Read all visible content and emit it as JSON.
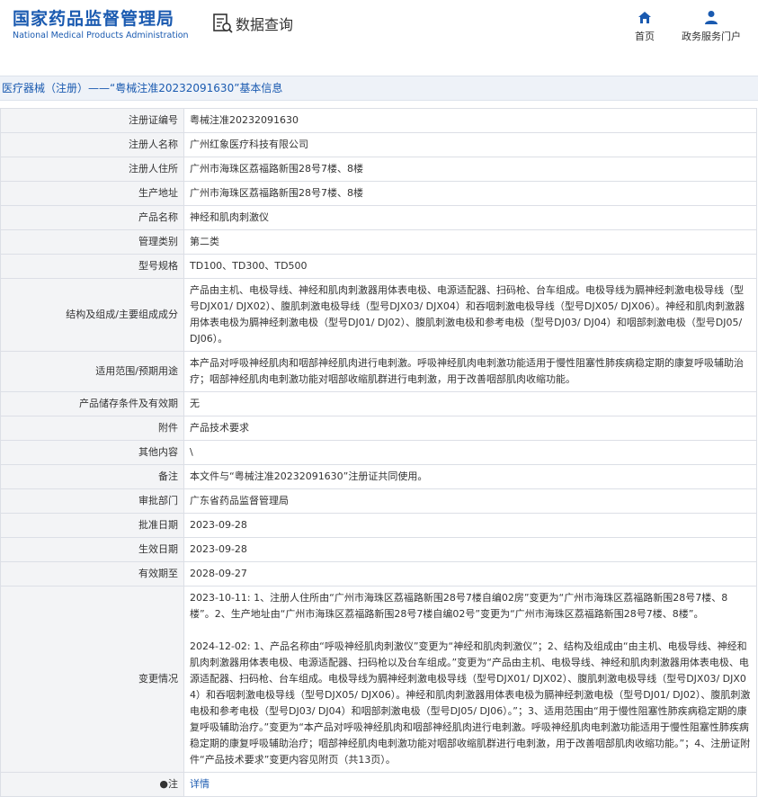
{
  "header": {
    "logo_cn": "国家药品监督管理局",
    "logo_en": "National Medical Products Administration",
    "title": "数据查询",
    "nav": [
      {
        "label": "首页",
        "icon": "home-icon"
      },
      {
        "label": "政务服务门户",
        "icon": "user-icon"
      }
    ]
  },
  "breadcrumb": "医疗器械（注册）——“粤械注准20232091630”基本信息",
  "rows": [
    {
      "key": "注册证编号",
      "value": "粤械注准20232091630"
    },
    {
      "key": "注册人名称",
      "value": "广州红象医疗科技有限公司"
    },
    {
      "key": "注册人住所",
      "value": "广州市海珠区荔福路新围28号7楼、8楼"
    },
    {
      "key": "生产地址",
      "value": "广州市海珠区荔福路新围28号7楼、8楼"
    },
    {
      "key": "产品名称",
      "value": "神经和肌肉刺激仪"
    },
    {
      "key": "管理类别",
      "value": "第二类"
    },
    {
      "key": "型号规格",
      "value": "TD100、TD300、TD500"
    },
    {
      "key": "结构及组成/主要组成成分",
      "value": "产品由主机、电极导线、神经和肌肉刺激器用体表电极、电源适配器、扫码枪、台车组成。电极导线为膈神经刺激电极导线（型号DJX01/ DJX02）、腹肌刺激电极导线（型号DJX03/ DJX04）和吞咽刺激电极导线（型号DJX05/ DJX06）。神经和肌肉刺激器用体表电极为膈神经刺激电极（型号DJ01/ DJ02）、腹肌刺激电极和参考电极（型号DJ03/ DJ04）和咽部刺激电极（型号DJ05/ DJ06）。"
    },
    {
      "key": "适用范围/预期用途",
      "value": "本产品对呼吸神经肌肉和咽部神经肌肉进行电刺激。呼吸神经肌肉电刺激功能适用于慢性阻塞性肺疾病稳定期的康复呼吸辅助治疗；咽部神经肌肉电刺激功能对咽部收缩肌群进行电刺激，用于改善咽部肌肉收缩功能。"
    },
    {
      "key": "产品储存条件及有效期",
      "value": "无"
    },
    {
      "key": "附件",
      "value": "产品技术要求"
    },
    {
      "key": "其他内容",
      "value": "\\"
    },
    {
      "key": "备注",
      "value": "本文件与“粤械注准20232091630”注册证共同使用。"
    },
    {
      "key": "审批部门",
      "value": "广东省药品监督管理局"
    },
    {
      "key": "批准日期",
      "value": "2023-09-28"
    },
    {
      "key": "生效日期",
      "value": "2023-09-28"
    },
    {
      "key": "有效期至",
      "value": "2028-09-27"
    }
  ],
  "changes": {
    "key": "变更情况",
    "part1": "2023-10-11: 1、注册人住所由“广州市海珠区荔福路新围28号7楼自编02房”变更为“广州市海珠区荔福路新围28号7楼、8楼”。2、生产地址由“广州市海珠区荔福路新围28号7楼自编02号”变更为“广州市海珠区荔福路新围28号7楼、8楼”。",
    "part2": "2024-12-02: 1、产品名称由“呼吸神经肌肉刺激仪”变更为“神经和肌肉刺激仪”；2、结构及组成由“由主机、电极导线、神经和肌肉刺激器用体表电极、电源适配器、扫码枪以及台车组成。”变更为“产品由主机、电极导线、神经和肌肉刺激器用体表电极、电源适配器、扫码枪、台车组成。电极导线为膈神经刺激电极导线（型号DJX01/ DJX02）、腹肌刺激电极导线（型号DJX03/ DJX04）和吞咽刺激电极导线（型号DJX05/ DJX06）。神经和肌肉刺激器用体表电极为膈神经刺激电极（型号DJ01/ DJ02）、腹肌刺激电极和参考电极（型号DJ03/ DJ04）和咽部刺激电极（型号DJ05/ DJ06）。”；3、适用范围由“用于慢性阻塞性肺疾病稳定期的康复呼吸辅助治疗。”变更为“本产品对呼吸神经肌肉和咽部神经肌肉进行电刺激。呼吸神经肌肉电刺激功能适用于慢性阻塞性肺疾病稳定期的康复呼吸辅助治疗；咽部神经肌肉电刺激功能对咽部收缩肌群进行电刺激，用于改善咽部肌肉收缩功能。”；4、注册证附件“产品技术要求”变更内容见附页（共13页）。"
  },
  "note": {
    "key": "●注",
    "link": "详情"
  }
}
